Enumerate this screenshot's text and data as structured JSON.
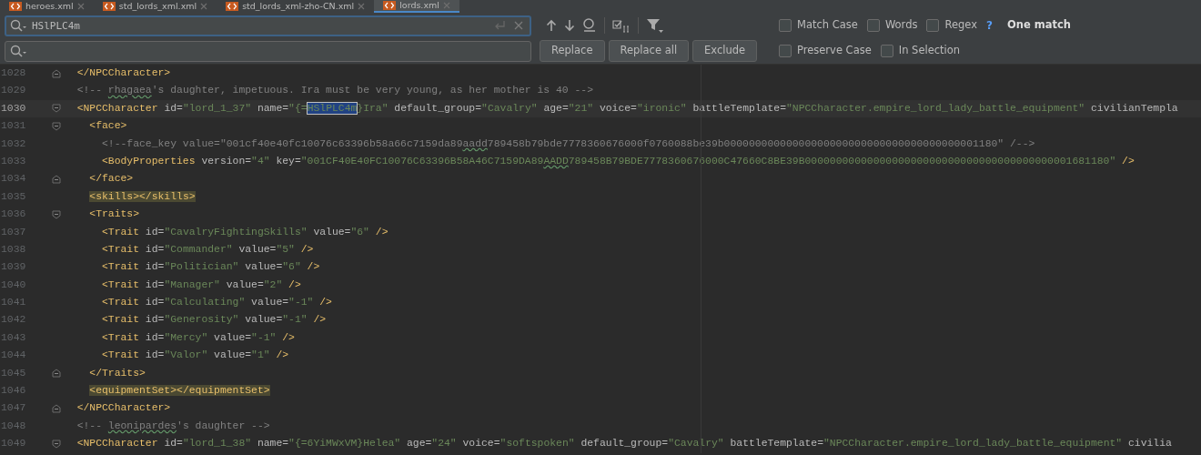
{
  "tabs": [
    {
      "label": "heroes.xml",
      "selected": false
    },
    {
      "label": "std_lords_xml.xml",
      "selected": false
    },
    {
      "label": "std_lords_xml-zho-CN.xml",
      "selected": false
    },
    {
      "label": "lords.xml",
      "selected": true
    }
  ],
  "find": {
    "query": "HSlPLC4m",
    "help": "?",
    "result": "One match",
    "options": [
      {
        "label": "Match Case",
        "checked": false
      },
      {
        "label": "Words",
        "checked": false
      },
      {
        "label": "Regex",
        "checked": false
      }
    ]
  },
  "replace": {
    "buttons": [
      "Replace",
      "Replace all",
      "Exclude"
    ],
    "options": [
      {
        "label": "Preserve Case",
        "checked": false
      },
      {
        "label": "In Selection",
        "checked": false
      }
    ]
  },
  "editor": {
    "lines": [
      {
        "number": "1028",
        "kind": "foldend",
        "current": false,
        "tokens": [
          {
            "kind": "tag",
            "text": "  </NPCCharacter>"
          }
        ]
      },
      {
        "number": "1029",
        "kind": "plain",
        "current": false,
        "tokens": [
          {
            "kind": "comment",
            "text": "  <!-- "
          },
          {
            "kind": "spellcomment",
            "text": "rhagaea"
          },
          {
            "kind": "comment",
            "text": "'s daughter, impetuous. Ira must be very young, as her mother is 40 -->"
          }
        ]
      },
      {
        "number": "1030",
        "kind": "foldstart",
        "current": true,
        "tokens": [
          {
            "kind": "tag",
            "text": "  <NPCCharacter"
          },
          {
            "kind": "attr",
            "text": " id="
          },
          {
            "kind": "str",
            "text": "\"lord_1_37\""
          },
          {
            "kind": "attr",
            "text": " name="
          },
          {
            "kind": "str",
            "text": "\"{="
          },
          {
            "kind": "match",
            "text": "HSlPLC4m"
          },
          {
            "kind": "str",
            "text": "}Ira\""
          },
          {
            "kind": "attr",
            "text": " default_group="
          },
          {
            "kind": "str",
            "text": "\"Cavalry\""
          },
          {
            "kind": "attr",
            "text": " age="
          },
          {
            "kind": "str",
            "text": "\"21\""
          },
          {
            "kind": "attr",
            "text": " voice="
          },
          {
            "kind": "str",
            "text": "\"ironic\""
          },
          {
            "kind": "attr",
            "text": " battleTemplate="
          },
          {
            "kind": "str",
            "text": "\"NPCCharacter.empire_lord_lady_battle_equipment\""
          },
          {
            "kind": "attr",
            "text": " civilianTempla"
          }
        ]
      },
      {
        "number": "1031",
        "kind": "foldstart",
        "current": false,
        "tokens": [
          {
            "kind": "tag",
            "text": "    <face>"
          }
        ]
      },
      {
        "number": "1032",
        "kind": "plain",
        "current": false,
        "tokens": [
          {
            "kind": "comment",
            "text": "      <!--face_key value=\"001cf40e40fc10076c63396b58a66c7159da89"
          },
          {
            "kind": "spellcomment",
            "text": "aadd"
          },
          {
            "kind": "comment",
            "text": "789458b79bde7778360676000f0760088be39b00000000000000000000000000000000000000001180\" /-->"
          }
        ]
      },
      {
        "number": "1033",
        "kind": "plain",
        "current": false,
        "tokens": [
          {
            "kind": "tag",
            "text": "      <BodyProperties"
          },
          {
            "kind": "attr",
            "text": " version="
          },
          {
            "kind": "str",
            "text": "\"4\""
          },
          {
            "kind": "attr",
            "text": " key="
          },
          {
            "kind": "str",
            "text": "\"001CF40E40FC10076C63396B58A46C7159DA89"
          },
          {
            "kind": "spellstr",
            "text": "AADD"
          },
          {
            "kind": "str",
            "text": "789458B79BDE7778360676000C47660C8BE39B0000000000000000000000000000000000000000001681180\""
          },
          {
            "kind": "tag",
            "text": " />"
          }
        ]
      },
      {
        "number": "1034",
        "kind": "foldend",
        "current": false,
        "tokens": [
          {
            "kind": "tag",
            "text": "    </face>"
          }
        ]
      },
      {
        "number": "1035",
        "kind": "plain",
        "current": false,
        "tokens": [
          {
            "kind": "pairtag",
            "text": "    <skills></skills>"
          }
        ]
      },
      {
        "number": "1036",
        "kind": "foldstart",
        "current": false,
        "tokens": [
          {
            "kind": "tag",
            "text": "    <Traits>"
          }
        ]
      },
      {
        "number": "1037",
        "kind": "plain",
        "current": false,
        "tokens": [
          {
            "kind": "tag",
            "text": "      <Trait"
          },
          {
            "kind": "attr",
            "text": " id="
          },
          {
            "kind": "str",
            "text": "\"CavalryFightingSkills\""
          },
          {
            "kind": "attr",
            "text": " value="
          },
          {
            "kind": "str",
            "text": "\"6\""
          },
          {
            "kind": "tag",
            "text": " />"
          }
        ]
      },
      {
        "number": "1038",
        "kind": "plain",
        "current": false,
        "tokens": [
          {
            "kind": "tag",
            "text": "      <Trait"
          },
          {
            "kind": "attr",
            "text": " id="
          },
          {
            "kind": "str",
            "text": "\"Commander\""
          },
          {
            "kind": "attr",
            "text": " value="
          },
          {
            "kind": "str",
            "text": "\"5\""
          },
          {
            "kind": "tag",
            "text": " />"
          }
        ]
      },
      {
        "number": "1039",
        "kind": "plain",
        "current": false,
        "tokens": [
          {
            "kind": "tag",
            "text": "      <Trait"
          },
          {
            "kind": "attr",
            "text": " id="
          },
          {
            "kind": "str",
            "text": "\"Politician\""
          },
          {
            "kind": "attr",
            "text": " value="
          },
          {
            "kind": "str",
            "text": "\"6\""
          },
          {
            "kind": "tag",
            "text": " />"
          }
        ]
      },
      {
        "number": "1040",
        "kind": "plain",
        "current": false,
        "tokens": [
          {
            "kind": "tag",
            "text": "      <Trait"
          },
          {
            "kind": "attr",
            "text": " id="
          },
          {
            "kind": "str",
            "text": "\"Manager\""
          },
          {
            "kind": "attr",
            "text": " value="
          },
          {
            "kind": "str",
            "text": "\"2\""
          },
          {
            "kind": "tag",
            "text": " />"
          }
        ]
      },
      {
        "number": "1041",
        "kind": "plain",
        "current": false,
        "tokens": [
          {
            "kind": "tag",
            "text": "      <Trait"
          },
          {
            "kind": "attr",
            "text": " id="
          },
          {
            "kind": "str",
            "text": "\"Calculating\""
          },
          {
            "kind": "attr",
            "text": " value="
          },
          {
            "kind": "str",
            "text": "\"-1\""
          },
          {
            "kind": "tag",
            "text": " />"
          }
        ]
      },
      {
        "number": "1042",
        "kind": "plain",
        "current": false,
        "tokens": [
          {
            "kind": "tag",
            "text": "      <Trait"
          },
          {
            "kind": "attr",
            "text": " id="
          },
          {
            "kind": "str",
            "text": "\"Generosity\""
          },
          {
            "kind": "attr",
            "text": " value="
          },
          {
            "kind": "str",
            "text": "\"-1\""
          },
          {
            "kind": "tag",
            "text": " />"
          }
        ]
      },
      {
        "number": "1043",
        "kind": "plain",
        "current": false,
        "tokens": [
          {
            "kind": "tag",
            "text": "      <Trait"
          },
          {
            "kind": "attr",
            "text": " id="
          },
          {
            "kind": "str",
            "text": "\"Mercy\""
          },
          {
            "kind": "attr",
            "text": " value="
          },
          {
            "kind": "str",
            "text": "\"-1\""
          },
          {
            "kind": "tag",
            "text": " />"
          }
        ]
      },
      {
        "number": "1044",
        "kind": "plain",
        "current": false,
        "tokens": [
          {
            "kind": "tag",
            "text": "      <Trait"
          },
          {
            "kind": "attr",
            "text": " id="
          },
          {
            "kind": "str",
            "text": "\"Valor\""
          },
          {
            "kind": "attr",
            "text": " value="
          },
          {
            "kind": "str",
            "text": "\"1\""
          },
          {
            "kind": "tag",
            "text": " />"
          }
        ]
      },
      {
        "number": "1045",
        "kind": "foldend",
        "current": false,
        "tokens": [
          {
            "kind": "tag",
            "text": "    </Traits>"
          }
        ]
      },
      {
        "number": "1046",
        "kind": "plain",
        "current": false,
        "tokens": [
          {
            "kind": "pairtag",
            "text": "    <equipmentSet></equipmentSet>"
          }
        ]
      },
      {
        "number": "1047",
        "kind": "foldend",
        "current": false,
        "tokens": [
          {
            "kind": "tag",
            "text": "  </NPCCharacter>"
          }
        ]
      },
      {
        "number": "1048",
        "kind": "plain",
        "current": false,
        "tokens": [
          {
            "kind": "comment",
            "text": "  <!-- "
          },
          {
            "kind": "spellcomment",
            "text": "leonipardes"
          },
          {
            "kind": "comment",
            "text": "'s daughter -->"
          }
        ]
      },
      {
        "number": "1049",
        "kind": "foldstart",
        "current": false,
        "tokens": [
          {
            "kind": "tag",
            "text": "  <NPCCharacter"
          },
          {
            "kind": "attr",
            "text": " id="
          },
          {
            "kind": "str",
            "text": "\"lord_1_38\""
          },
          {
            "kind": "attr",
            "text": " name="
          },
          {
            "kind": "str",
            "text": "\"{=6YiMWxVM}Helea\""
          },
          {
            "kind": "attr",
            "text": " age="
          },
          {
            "kind": "str",
            "text": "\"24\""
          },
          {
            "kind": "attr",
            "text": " voice="
          },
          {
            "kind": "str",
            "text": "\"softspoken\""
          },
          {
            "kind": "attr",
            "text": " default_group="
          },
          {
            "kind": "str",
            "text": "\"Cavalry\""
          },
          {
            "kind": "attr",
            "text": " battleTemplate="
          },
          {
            "kind": "str",
            "text": "\"NPCCharacter.empire_lord_lady_battle_equipment\""
          },
          {
            "kind": "attr",
            "text": " civilia"
          }
        ]
      }
    ]
  }
}
